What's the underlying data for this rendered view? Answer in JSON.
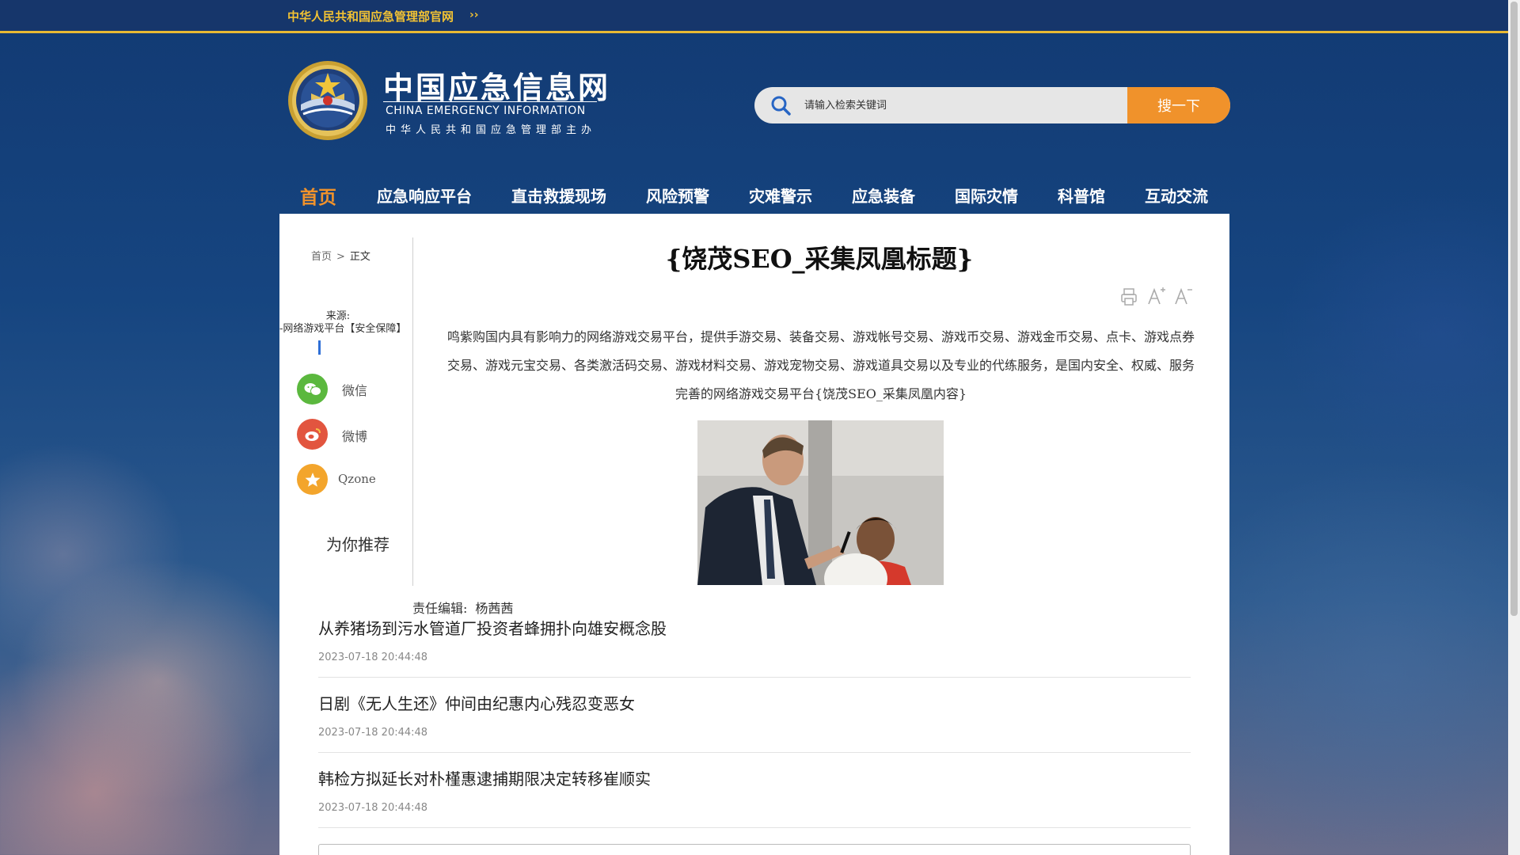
{
  "topbar": {
    "link": "中华人民共和国应急管理部官网",
    "arrow": "››"
  },
  "logo": {
    "title": "中国应急信息网",
    "subtitle_en": "CHINA EMERGENCY INFORMATION",
    "subtitle_cn": "中华人民共和国应急管理部主办",
    "seal_icon": "emblem-seal"
  },
  "search": {
    "placeholder": "请输入检索关键词",
    "button": "搜一下",
    "icon": "search-icon"
  },
  "nav": [
    {
      "label": "首页",
      "active": true
    },
    {
      "label": "应急响应平台"
    },
    {
      "label": "直击救援现场"
    },
    {
      "label": "风险预警"
    },
    {
      "label": "灾难警示"
    },
    {
      "label": "应急装备"
    },
    {
      "label": "国际灾情"
    },
    {
      "label": "科普馆"
    },
    {
      "label": "互动交流"
    }
  ],
  "breadcrumb": {
    "home": "首页",
    "sep": ">",
    "current": "正文"
  },
  "source": {
    "label": "来源:",
    "value": "-网络游戏平台【安全保障】"
  },
  "share": [
    {
      "label": "微信",
      "icon": "wechat-icon",
      "color": "#5bb83e"
    },
    {
      "label": "微博",
      "icon": "weibo-icon",
      "color": "#e2553f"
    },
    {
      "label": "Qzone",
      "icon": "qzone-icon",
      "color": "#f3a52c"
    }
  ],
  "recommend_label": "为你推荐",
  "article": {
    "title": "{饶茂SEO_采集凤凰标题}",
    "body": "鸣紫购国内具有影响力的网络游戏交易平台，提供手游交易、装备交易、游戏帐号交易、游戏币交易、游戏金币交易、点卡、游戏点券交易、游戏元宝交易、各类激活码交易、游戏材料交易、游戏宠物交易、游戏道具交易以及专业的代练服务，是国内安全、权威、服务完善的网络游戏交易平台{饶茂SEO_采集凤凰内容}",
    "tools": [
      "print-icon",
      "font-increase-icon",
      "font-decrease-icon"
    ],
    "editor_label": "责任编辑:",
    "editor_name": "杨茜茜"
  },
  "related": [
    {
      "title": "从养猪场到污水管道厂投资者蜂拥扑向雄安概念股",
      "date": "2023-07-18 20:44:48"
    },
    {
      "title": "日剧《无人生还》仲间由纪惠内心残忍变恶女",
      "date": "2023-07-18 20:44:48"
    },
    {
      "title": "韩检方拟延长对朴槿惠逮捕期限决定转移崔顺实",
      "date": "2023-07-18 20:44:48"
    }
  ],
  "colors": {
    "accent": "#f0922b",
    "topbar_gold": "#f2c233",
    "header_blue": "#16366b"
  }
}
